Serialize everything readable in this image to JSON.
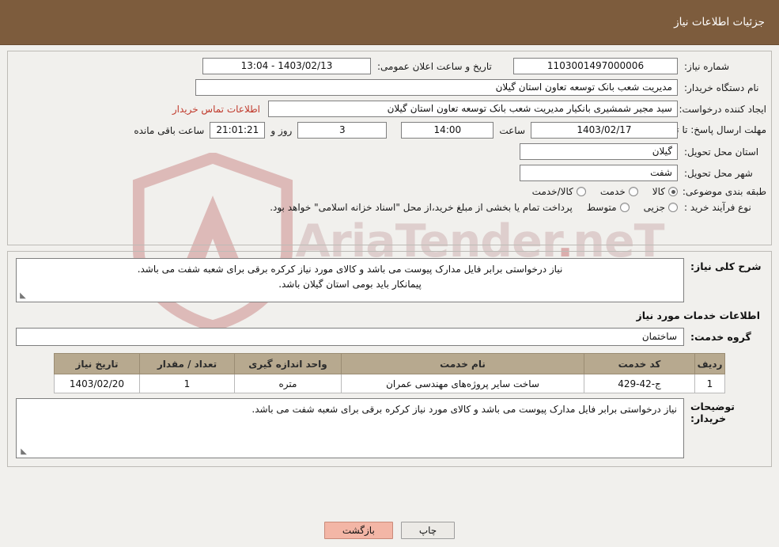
{
  "header": {
    "title": "جزئیات اطلاعات نیاز"
  },
  "watermark": {
    "text_left": "AriaTender",
    "text_dot": ".",
    "text_right": "neT"
  },
  "form": {
    "need_number": {
      "label": "شماره نیاز:",
      "value": "1103001497000006"
    },
    "announce_datetime": {
      "label": "تاریخ و ساعت اعلان عمومی:",
      "value": "1403/02/13 - 13:04"
    },
    "buyer_org": {
      "label": "نام دستگاه خریدار:",
      "value": "مدیریت شعب بانک توسعه تعاون استان گیلان"
    },
    "creator": {
      "label": "ایجاد کننده درخواست:",
      "value": "سید مجیر شمشیری بانکیار مدیریت شعب بانک توسعه تعاون استان گیلان",
      "contact_link": "اطلاعات تماس خریدار"
    },
    "deadline": {
      "label": "مهلت ارسال پاسخ: تا تاریخ:",
      "date": "1403/02/17",
      "time_label": "ساعت",
      "time": "14:00",
      "days": "3",
      "days_label": "روز و",
      "countdown": "21:01:21",
      "countdown_label": "ساعت باقی مانده"
    },
    "province": {
      "label": "استان محل تحویل:",
      "value": "گیلان"
    },
    "city": {
      "label": "شهر محل تحویل:",
      "value": "شفت"
    },
    "category": {
      "label": "طبقه بندی موضوعی:",
      "options": [
        {
          "label": "کالا",
          "checked": true
        },
        {
          "label": "خدمت",
          "checked": false
        },
        {
          "label": "کالا/خدمت",
          "checked": false
        }
      ]
    },
    "purchase_type": {
      "label": "نوع فرآیند خرید :",
      "options": [
        {
          "label": "جزیی",
          "checked": false
        },
        {
          "label": "متوسط",
          "checked": false
        }
      ],
      "note": "پرداخت تمام یا بخشی از مبلغ خرید،از محل \"اسناد خزانه اسلامی\" خواهد بود."
    }
  },
  "summary": {
    "label": "شرح کلی نیاز:",
    "text_line1": "نیاز درخواستی برابر فایل مدارک پیوست می باشد و کالای مورد نیاز کرکره برقی برای شعبه شفت می باشد.",
    "text_line2": "پیمانکار باید بومی استان گیلان باشد."
  },
  "services_section": {
    "title": "اطلاعات خدمات مورد نیاز"
  },
  "service_group": {
    "label": "گروه خدمت:",
    "value": "ساختمان"
  },
  "table": {
    "headers": [
      "ردیف",
      "کد خدمت",
      "نام خدمت",
      "واحد اندازه گیری",
      "تعداد / مقدار",
      "تاریخ نیاز"
    ],
    "rows": [
      {
        "row": "1",
        "code": "ج-42-429",
        "name": "ساخت سایر پروژه‌های مهندسی عمران",
        "unit": "متره",
        "qty": "1",
        "date": "1403/02/20"
      }
    ]
  },
  "buyer_notes": {
    "label": "توضیحات خریدار:",
    "text": "نیاز درخواستی برابر فایل مدارک پیوست می باشد و کالای مورد نیاز کرکره برقی برای شعبه شفت می باشد."
  },
  "footer": {
    "print_label": "چاپ",
    "back_label": "بازگشت"
  }
}
